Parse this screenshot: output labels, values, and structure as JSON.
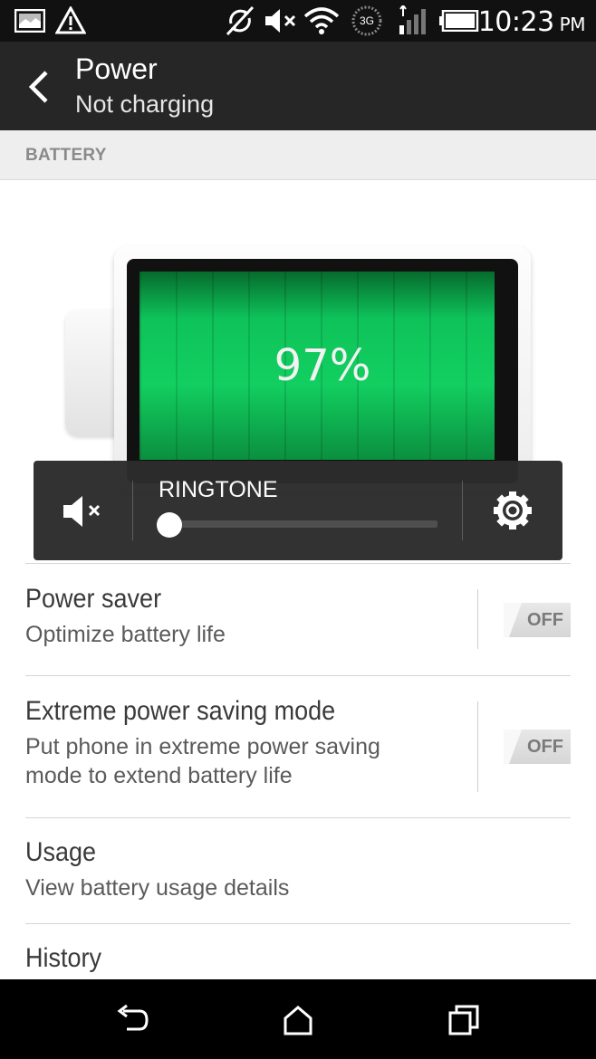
{
  "status_bar": {
    "time": "10:23",
    "ampm": "PM",
    "network": "3G",
    "icons": [
      "gallery-icon",
      "warning-icon",
      "sync-off-icon",
      "mute-icon",
      "wifi-icon",
      "network-3g-icon",
      "signal-icon",
      "battery-icon"
    ]
  },
  "action_bar": {
    "title": "Power",
    "subtitle": "Not charging"
  },
  "section": {
    "header": "BATTERY"
  },
  "battery": {
    "percent_label": "97%",
    "level": 0.97,
    "fill_color": "#12cf60"
  },
  "ringtone": {
    "label": "RINGTONE",
    "volume": 0
  },
  "settings": [
    {
      "title": "Power saver",
      "subtitle": "Optimize battery life",
      "toggle": "OFF"
    },
    {
      "title": "Extreme power saving mode",
      "subtitle": "Put phone in extreme power saving mode to extend battery life",
      "toggle": "OFF"
    },
    {
      "title": "Usage",
      "subtitle": "View battery usage details"
    },
    {
      "title": "History"
    }
  ],
  "colors": {
    "status_bar": "#111111",
    "action_bar": "#262626",
    "battery_green": "#12cf60"
  }
}
